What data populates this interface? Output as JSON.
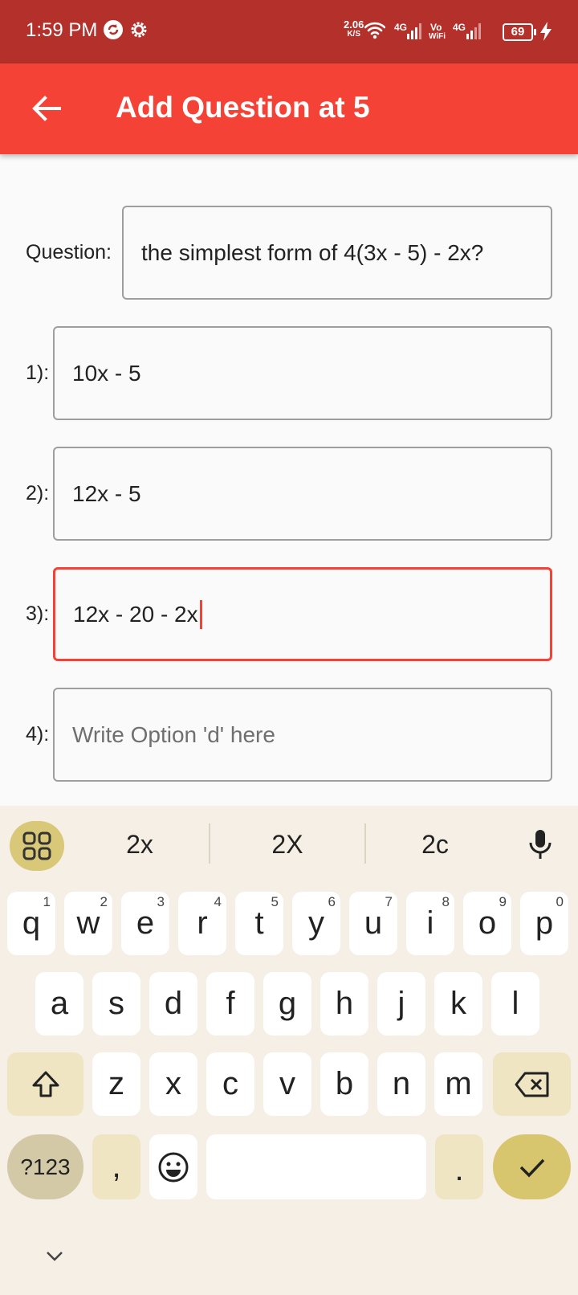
{
  "status_bar": {
    "time": "1:59 PM",
    "net_speed_value": "2.06",
    "net_speed_unit": "K/S",
    "sim1": "4G",
    "volte": "Vo",
    "wifi_label": "WiFi",
    "sim2": "4G",
    "battery": "69"
  },
  "app_bar": {
    "title": "Add Question at 5"
  },
  "form": {
    "question_label": "Question:",
    "question_value": "the simplest form of 4(3x - 5) - 2x?",
    "options": [
      {
        "label": "1):",
        "value": "10x - 5",
        "placeholder": ""
      },
      {
        "label": "2):",
        "value": "12x - 5",
        "placeholder": ""
      },
      {
        "label": "3):",
        "value": "12x - 20 - 2x",
        "placeholder": ""
      },
      {
        "label": "4):",
        "value": "",
        "placeholder": "Write Option 'd' here"
      }
    ]
  },
  "keyboard": {
    "suggestions": [
      "2x",
      "2X",
      "2c"
    ],
    "row1": [
      "q",
      "w",
      "e",
      "r",
      "t",
      "y",
      "u",
      "i",
      "o",
      "p"
    ],
    "row1_hints": [
      "1",
      "2",
      "3",
      "4",
      "5",
      "6",
      "7",
      "8",
      "9",
      "0"
    ],
    "row2": [
      "a",
      "s",
      "d",
      "f",
      "g",
      "h",
      "j",
      "k",
      "l"
    ],
    "row3": [
      "z",
      "x",
      "c",
      "v",
      "b",
      "n",
      "m"
    ],
    "symbols_label": "?123",
    "comma": ",",
    "period": "."
  },
  "colors": {
    "status_bar": "#b3302b",
    "app_bar": "#f44336",
    "focus_border": "#f44336",
    "keyboard_bg": "#f6efe5",
    "enter_key": "#d8c66e"
  }
}
